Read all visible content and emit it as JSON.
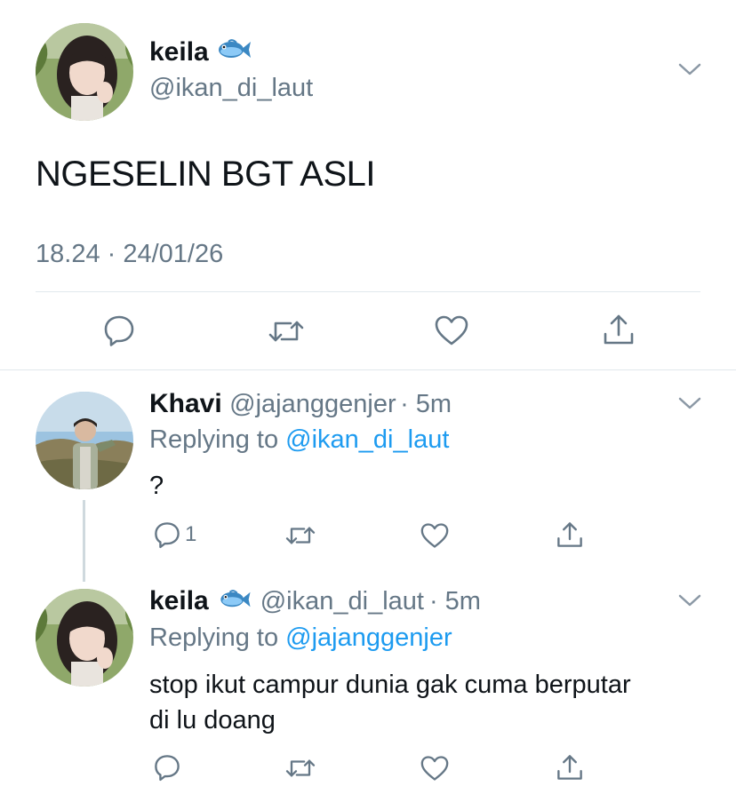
{
  "main_tweet": {
    "display_name": "keila",
    "emoji": "🐟",
    "handle": "@ikan_di_laut",
    "text": "NGESELIN BGT ASLI",
    "timestamp": "18.24 · 24/01/26"
  },
  "replies": [
    {
      "display_name": "Khavi",
      "handle": "@jajanggenjer",
      "time": "· 5m",
      "replying_prefix": "Replying to ",
      "replying_to": "@ikan_di_laut",
      "text": "?",
      "reply_count": "1"
    },
    {
      "display_name": "keila",
      "emoji": "🐟",
      "handle": "@ikan_di_laut",
      "time": "· 5m",
      "replying_prefix": "Replying to ",
      "replying_to": "@jajanggenjer",
      "text_line1": "stop ikut campur dunia gak cuma berputar",
      "text_line2": "di lu doang"
    }
  ],
  "icons": {
    "reply": "reply-icon",
    "retweet": "retweet-icon",
    "like": "heart-icon",
    "share": "share-icon",
    "more": "chevron-down-icon"
  },
  "colors": {
    "link": "#1d9bf0",
    "secondary_text": "#657786",
    "divider": "#e1e8ed"
  }
}
